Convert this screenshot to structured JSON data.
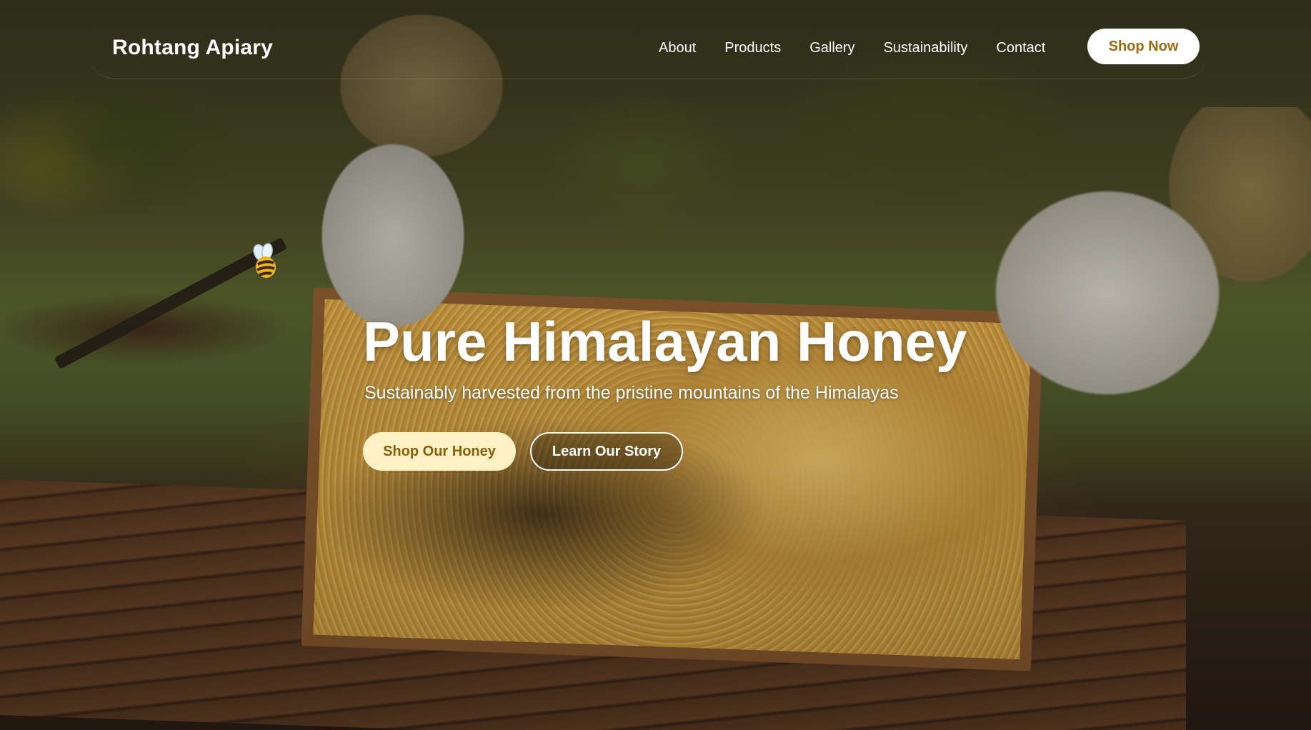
{
  "navbar": {
    "brand": "Rohtang Apiary",
    "links": [
      {
        "label": "About"
      },
      {
        "label": "Products"
      },
      {
        "label": "Gallery"
      },
      {
        "label": "Sustainability"
      },
      {
        "label": "Contact"
      }
    ],
    "cta_label": "Shop Now"
  },
  "hero": {
    "title": "Pure Himalayan Honey",
    "subtitle": "Sustainably harvested from the pristine mountains of the Himalayas",
    "primary_button": "Shop Our Honey",
    "secondary_button": "Learn Our Story",
    "decoration_icon": "bee-icon"
  },
  "colors": {
    "accent": "#9a6a0d",
    "primary_button_bg": "#fdf1c5",
    "text": "#ffffff"
  }
}
